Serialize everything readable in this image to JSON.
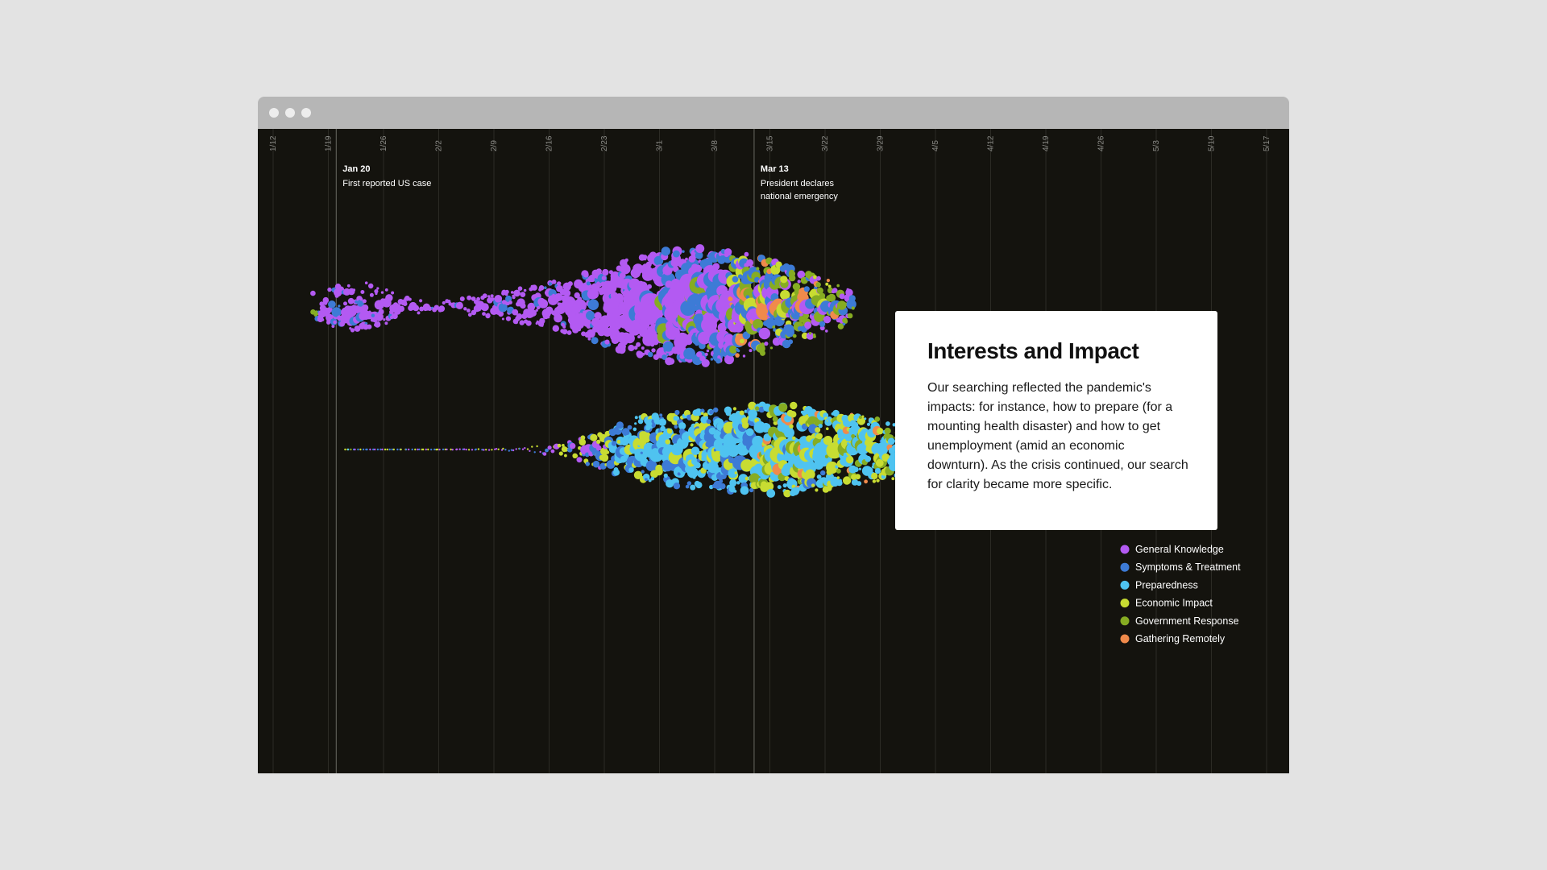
{
  "chart_data": {
    "type": "scatter",
    "x_tick_labels": [
      "1/12",
      "1/19",
      "1/26",
      "2/2",
      "2/9",
      "2/16",
      "2/23",
      "3/1",
      "3/8",
      "3/15",
      "3/22",
      "3/29",
      "4/5",
      "4/12",
      "4/19",
      "4/26",
      "5/3",
      "5/10",
      "5/17"
    ],
    "annotations": [
      {
        "date": "Jan 20",
        "lines": [
          "First reported US case"
        ]
      },
      {
        "date": "Mar 13",
        "lines": [
          "President declares",
          "national emergency"
        ]
      }
    ],
    "legend": [
      {
        "label": "General Knowledge",
        "color": "#b35af2"
      },
      {
        "label": "Symptoms & Treatment",
        "color": "#3d7bd6"
      },
      {
        "label": "Preparedness",
        "color": "#4fc3f0"
      },
      {
        "label": "Economic Impact",
        "color": "#c8dc32"
      },
      {
        "label": "Government Response",
        "color": "#86ac22"
      },
      {
        "label": "Gathering Remotely",
        "color": "#f08a4b"
      }
    ],
    "series_weights": {
      "upper": [
        {
          "start": "1/18",
          "end": "3/1",
          "mix": {
            "General Knowledge": 0.9,
            "Symptoms & Treatment": 0.1
          }
        },
        {
          "start": "3/1",
          "end": "3/10",
          "mix": {
            "General Knowledge": 0.55,
            "Symptoms & Treatment": 0.35,
            "Government Response": 0.1
          }
        },
        {
          "start": "3/10",
          "end": "4/12",
          "mix": {
            "General Knowledge": 0.3,
            "Symptoms & Treatment": 0.3,
            "Government Response": 0.25,
            "Economic Impact": 0.1,
            "Gathering Remotely": 0.05
          }
        }
      ],
      "lower": [
        {
          "start": "1/22",
          "end": "2/24",
          "mix": {
            "General Knowledge": 0.4,
            "Symptoms & Treatment": 0.3,
            "Economic Impact": 0.3
          }
        },
        {
          "start": "2/24",
          "end": "3/13",
          "mix": {
            "Preparedness": 0.55,
            "Symptoms & Treatment": 0.25,
            "Economic Impact": 0.2
          }
        },
        {
          "start": "3/13",
          "end": "5/11",
          "mix": {
            "Preparedness": 0.45,
            "Economic Impact": 0.3,
            "Government Response": 0.15,
            "Gathering Remotely": 0.05,
            "Symptoms & Treatment": 0.05
          }
        }
      ]
    }
  },
  "card": {
    "title": "Interests and Impact",
    "body": "Our searching reflected the pandemic's impacts: for instance, how to prepare (for a mounting health disaster) and how to get unemployment (amid an economic downturn). As the crisis continued, our search for clarity became more specific."
  }
}
